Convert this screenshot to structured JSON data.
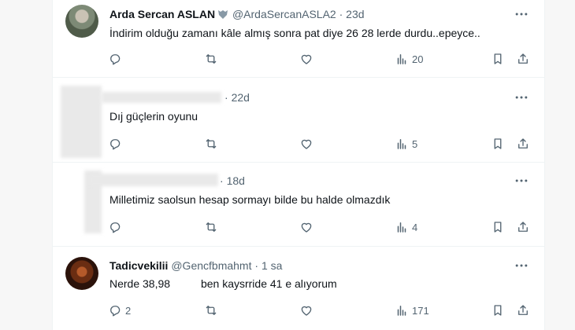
{
  "tweets": [
    {
      "name": "Arda Sercan ASLAN",
      "handle": "@ArdaSercanASLA2",
      "time": "23d",
      "text": "İndirim olduğu zamanı kâle almış sonra pat diye 26 28 lerde durdu..epeyce..",
      "reply_count": "",
      "retweet_count": "",
      "like_count": "",
      "view_count": "20"
    },
    {
      "name": "",
      "handle": "",
      "time": "22d",
      "text": "Dıj güçlerin oyunu",
      "reply_count": "",
      "retweet_count": "",
      "like_count": "",
      "view_count": "5"
    },
    {
      "name": "",
      "handle": "",
      "time": "18d",
      "text": "Milletimiz saolsun hesap sormayı bilde bu halde olmazdık",
      "reply_count": "",
      "retweet_count": "",
      "like_count": "",
      "view_count": "4"
    },
    {
      "name": "Tadicvekilii",
      "handle": "@Gencfbmahmt",
      "time": "1 sa",
      "text": "Nerde 38,98          ben kaysrride 41 e alıyorum",
      "reply_count": "2",
      "retweet_count": "",
      "like_count": "",
      "view_count": "171"
    }
  ],
  "icons": {
    "more": "more-icon",
    "reply": "reply-icon",
    "retweet": "retweet-icon",
    "like": "like-icon",
    "views": "views-icon",
    "bookmark": "bookmark-icon",
    "share": "share-icon"
  },
  "colors": {
    "text": "#0f1419",
    "secondary": "#536471",
    "divider": "#eff3f4"
  }
}
